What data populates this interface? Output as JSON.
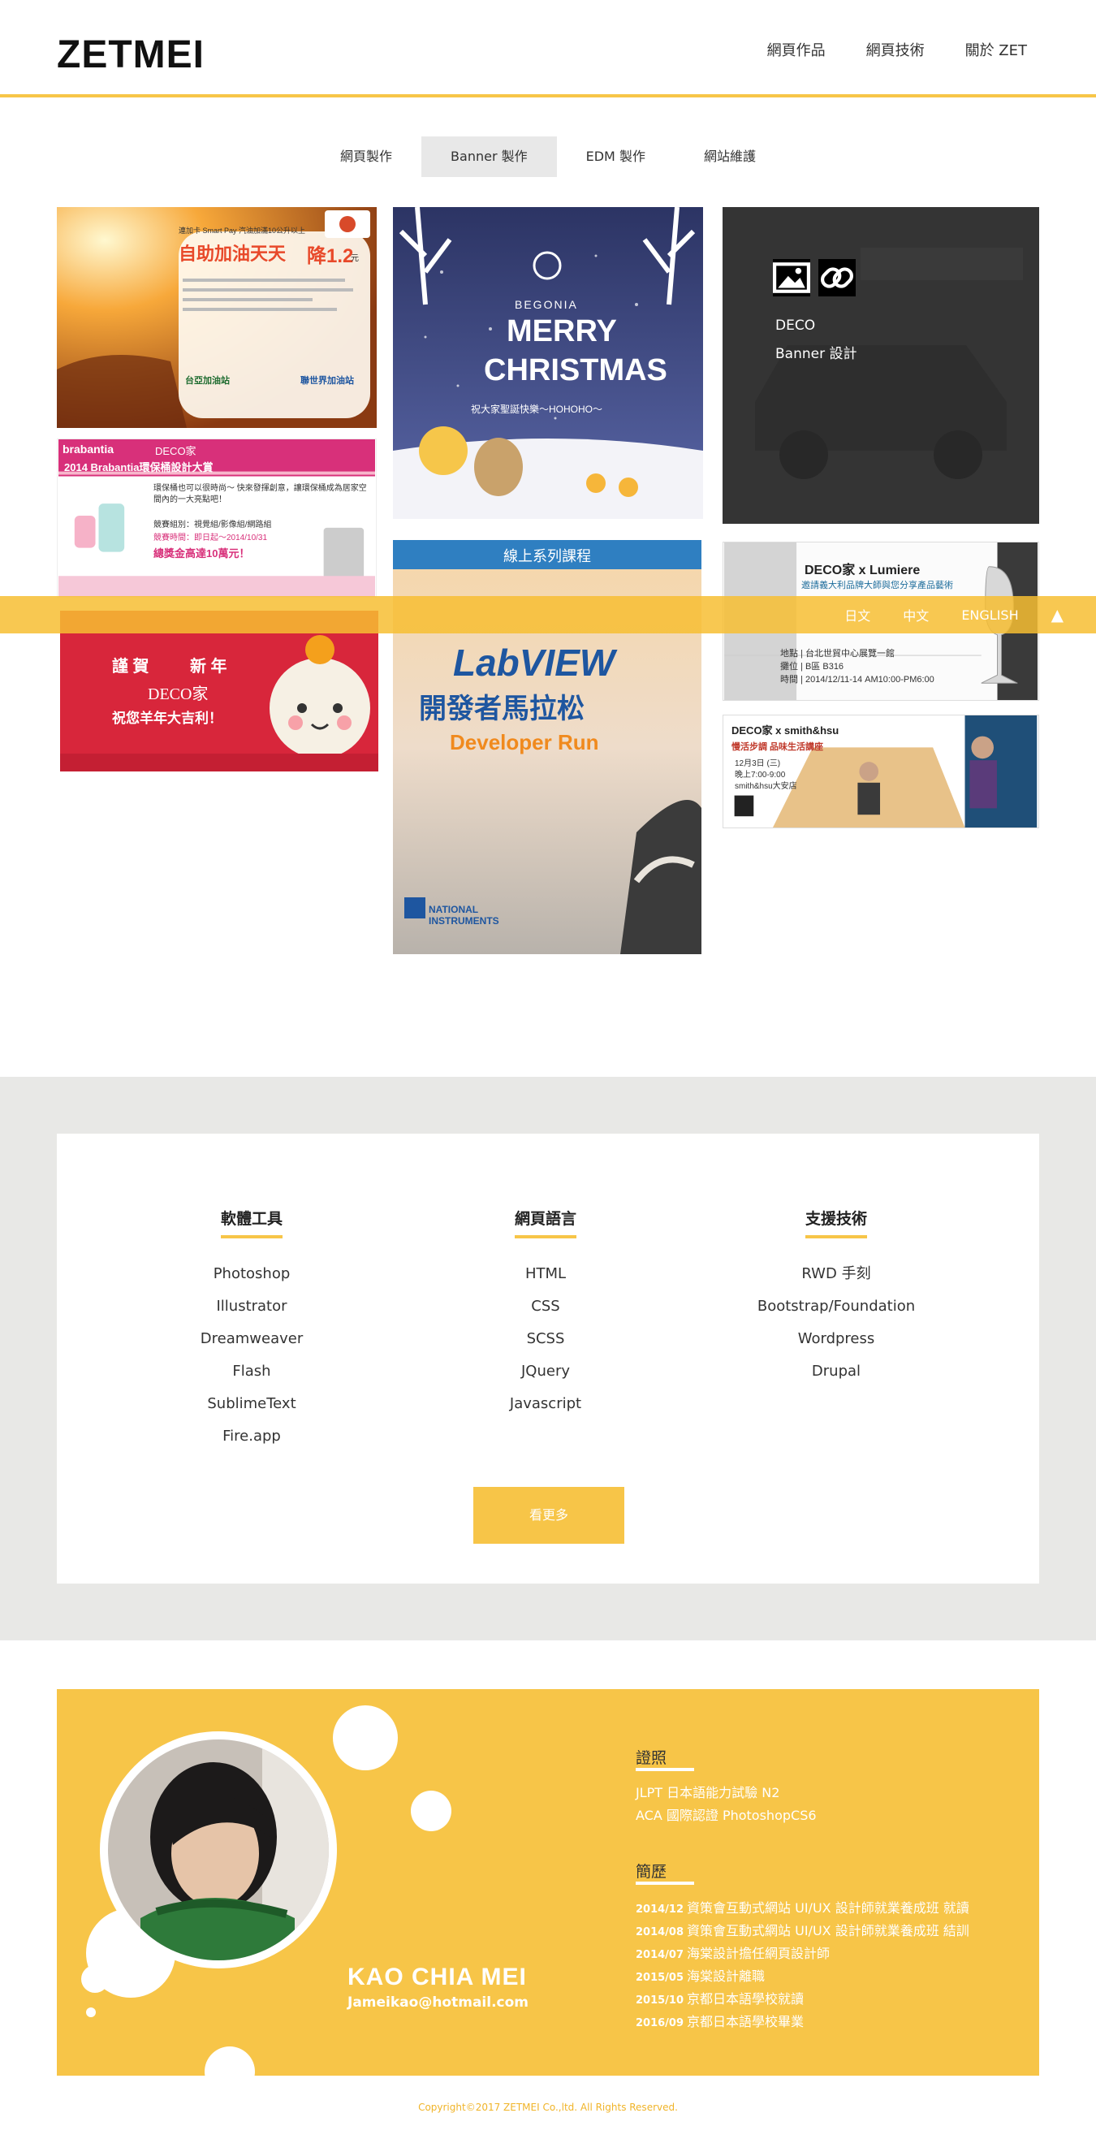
{
  "header": {
    "logo": "ZETMEI",
    "nav": [
      "網頁作品",
      "網頁技術",
      "關於 ZET"
    ]
  },
  "tabs": [
    "網頁製作",
    "Banner 製作",
    "EDM 製作",
    "網站維護"
  ],
  "active_tab_index": 1,
  "portfolio": {
    "fuel_banner": {
      "line1": "連加卡 Smart Pay 汽油加滿10公升以上",
      "headline": "自助加油天天",
      "drop": "降1.2",
      "unit": "元",
      "brand1": "台亞加油站",
      "brand2": "聯世界加油站"
    },
    "xmas": {
      "brand": "BEGONIA",
      "line1": "MERRY",
      "line2": "CHRISTMAS",
      "sub": "祝大家聖誕快樂～HOHOHO～"
    },
    "hover_tile": {
      "title": "DECO",
      "subtitle": "Banner 設計"
    },
    "brabantia": {
      "brand": "brabantia",
      "deco": "DECO家",
      "title": "2014 Brabantia環保桶設計大賞",
      "desc": "環保桶也可以很時尚～ 快來發揮創意，讓環保桶成為居家空間內的一大亮點吧！",
      "items": "競賽組別：視覺組/影像組/網路組",
      "time": "競賽時間：即日起～2014/10/31",
      "prize": "總獎金高達10萬元！"
    },
    "labview": {
      "top": "線上系列課程",
      "title1": "LabVIEW",
      "title2": "開發者馬拉松",
      "title3": "Developer Run",
      "brand": "NATIONAL INSTRUMENTS"
    },
    "lumiere": {
      "brand": "DECO家 x Lumiere",
      "sub": "邀請義大利品牌大師與您分享產品藝術",
      "place": "地點 | 台北世貿中心展覽一館",
      "booth": "攤位 | B區 B316",
      "time": "時間 | 2014/12/11-14 AM10:00-PM6:00"
    },
    "newyear": {
      "line1": "謹 賀",
      "line2": "新 年",
      "deco": "DECO家",
      "wish": "祝您羊年大吉利！"
    },
    "smithhsu": {
      "brand": "DECO家 x smith&hsu",
      "title": "慢活步調 品味生活講座",
      "date": "12月3日 (三)",
      "time": "晚上7:00-9:00",
      "place": "smith&hsu大安店"
    }
  },
  "langbar": {
    "langs": [
      "日文",
      "中文",
      "ENGLISH"
    ],
    "up": "▲"
  },
  "skills": {
    "columns": [
      {
        "title": "軟體工具",
        "items": [
          "Photoshop",
          "Illustrator",
          "Dreamweaver",
          "Flash",
          "SublimeText",
          "Fire.app"
        ]
      },
      {
        "title": "網頁語言",
        "items": [
          "HTML",
          "CSS",
          "SCSS",
          "JQuery",
          "Javascript"
        ]
      },
      {
        "title": "支援技術",
        "items": [
          "RWD 手刻",
          "Bootstrap/Foundation",
          "Wordpress",
          "Drupal"
        ]
      }
    ],
    "more": "看更多"
  },
  "profile": {
    "name": "KAO CHIA MEI",
    "email": "Jameikao@hotmail.com",
    "cert_title": "證照",
    "certs": [
      "JLPT 日本語能力試驗 N2",
      "ACA 國際認證 PhotoshopCS6"
    ],
    "exp_title": "簡歷",
    "exp": [
      {
        "yr": "2014/12",
        "text": "資策會互動式網站 UI/UX 設計師就業養成班 就讀"
      },
      {
        "yr": "2014/08",
        "text": "資策會互動式網站 UI/UX 設計師就業養成班 結訓"
      },
      {
        "yr": "2014/07",
        "text": "海棠設計擔任網頁設計師"
      },
      {
        "yr": "2015/05",
        "text": "海棠設計離職"
      },
      {
        "yr": "2015/10",
        "text": "京都日本語學校就讀"
      },
      {
        "yr": "2016/09",
        "text": "京都日本語學校畢業"
      }
    ]
  },
  "footer": "Copyright©2017 ZETMEI Co.,ltd. All Rights Reserved."
}
